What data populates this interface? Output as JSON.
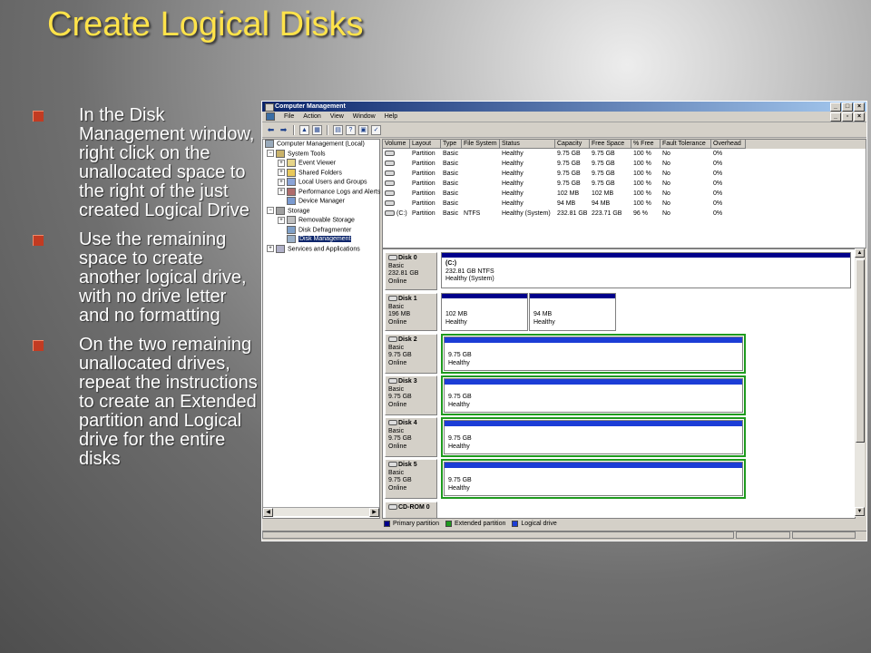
{
  "slide": {
    "title": "Create Logical Disks",
    "bullets": [
      "In the Disk Management window, right click on the unallocated space to the right of the just created Logical Drive",
      "Use the remaining space to create another logical drive, with no drive letter and no formatting",
      "On the two remaining unallocated drives, repeat the instructions to create an Extended partition and Logical drive for the entire disks"
    ]
  },
  "window": {
    "title": "Computer Management",
    "menu": [
      "File",
      "Action",
      "View",
      "Window",
      "Help"
    ],
    "tree": {
      "root": "Computer Management (Local)",
      "system_tools": "System Tools",
      "event_viewer": "Event Viewer",
      "shared_folders": "Shared Folders",
      "local_users": "Local Users and Groups",
      "perf_logs": "Performance Logs and Alerts",
      "device_manager": "Device Manager",
      "storage": "Storage",
      "removable_storage": "Removable Storage",
      "disk_defrag": "Disk Defragmenter",
      "disk_management": "Disk Management",
      "services": "Services and Applications"
    },
    "volume_columns": [
      "Volume",
      "Layout",
      "Type",
      "File System",
      "Status",
      "Capacity",
      "Free Space",
      "% Free",
      "Fault Tolerance",
      "Overhead"
    ],
    "volumes": [
      {
        "volume": "",
        "layout": "Partition",
        "type": "Basic",
        "fs": "",
        "status": "Healthy",
        "capacity": "9.75 GB",
        "free": "9.75 GB",
        "pct": "100 %",
        "fault": "No",
        "overhead": "0%"
      },
      {
        "volume": "",
        "layout": "Partition",
        "type": "Basic",
        "fs": "",
        "status": "Healthy",
        "capacity": "9.75 GB",
        "free": "9.75 GB",
        "pct": "100 %",
        "fault": "No",
        "overhead": "0%"
      },
      {
        "volume": "",
        "layout": "Partition",
        "type": "Basic",
        "fs": "",
        "status": "Healthy",
        "capacity": "9.75 GB",
        "free": "9.75 GB",
        "pct": "100 %",
        "fault": "No",
        "overhead": "0%"
      },
      {
        "volume": "",
        "layout": "Partition",
        "type": "Basic",
        "fs": "",
        "status": "Healthy",
        "capacity": "9.75 GB",
        "free": "9.75 GB",
        "pct": "100 %",
        "fault": "No",
        "overhead": "0%"
      },
      {
        "volume": "",
        "layout": "Partition",
        "type": "Basic",
        "fs": "",
        "status": "Healthy",
        "capacity": "102 MB",
        "free": "102 MB",
        "pct": "100 %",
        "fault": "No",
        "overhead": "0%"
      },
      {
        "volume": "",
        "layout": "Partition",
        "type": "Basic",
        "fs": "",
        "status": "Healthy",
        "capacity": "94 MB",
        "free": "94 MB",
        "pct": "100 %",
        "fault": "No",
        "overhead": "0%"
      },
      {
        "volume": "(C:)",
        "layout": "Partition",
        "type": "Basic",
        "fs": "NTFS",
        "status": "Healthy (System)",
        "capacity": "232.81 GB",
        "free": "223.71 GB",
        "pct": "96 %",
        "fault": "No",
        "overhead": "0%"
      }
    ],
    "disks": {
      "d0": {
        "name": "Disk 0",
        "type": "Basic",
        "size": "232.81 GB",
        "state": "Online",
        "p1": {
          "name": "(C:)",
          "info": "232.81 GB NTFS",
          "status": "Healthy (System)"
        }
      },
      "d1": {
        "name": "Disk 1",
        "type": "Basic",
        "size": "196 MB",
        "state": "Online",
        "p1": {
          "info": "102 MB",
          "status": "Healthy"
        },
        "p2": {
          "info": "94 MB",
          "status": "Healthy"
        }
      },
      "d2": {
        "name": "Disk 2",
        "type": "Basic",
        "size": "9.75 GB",
        "state": "Online",
        "p1": {
          "info": "9.75 GB",
          "status": "Healthy"
        }
      },
      "d3": {
        "name": "Disk 3",
        "type": "Basic",
        "size": "9.75 GB",
        "state": "Online",
        "p1": {
          "info": "9.75 GB",
          "status": "Healthy"
        }
      },
      "d4": {
        "name": "Disk 4",
        "type": "Basic",
        "size": "9.75 GB",
        "state": "Online",
        "p1": {
          "info": "9.75 GB",
          "status": "Healthy"
        }
      },
      "d5": {
        "name": "Disk 5",
        "type": "Basic",
        "size": "9.75 GB",
        "state": "Online",
        "p1": {
          "info": "9.75 GB",
          "status": "Healthy"
        }
      },
      "cd0": {
        "name": "CD-ROM 0"
      }
    },
    "legend": {
      "primary": "Primary partition",
      "extended": "Extended partition",
      "logical": "Logical drive"
    },
    "colors": {
      "primary": "#00008b",
      "extended": "#1e9a1e",
      "logical": "#1c3dd6",
      "title": "#ffe34a",
      "bullet": "#c23b22"
    }
  }
}
